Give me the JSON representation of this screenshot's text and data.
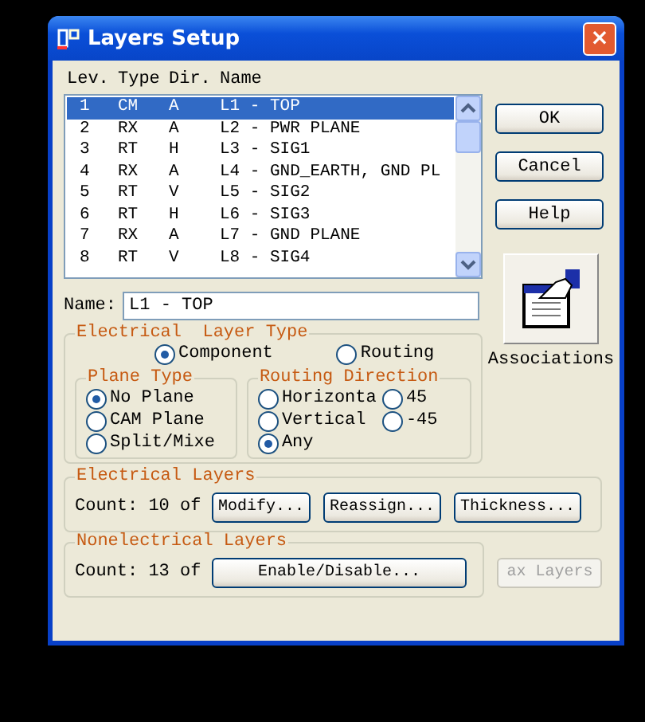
{
  "window": {
    "title": "Layers Setup",
    "close": "×"
  },
  "layer_list": {
    "columns": [
      "Lev.",
      "Type",
      "Dir.",
      "Name"
    ],
    "rows": [
      {
        "cells": [
          "1",
          "CM",
          "A",
          "L1 - TOP"
        ],
        "selected": true
      },
      {
        "cells": [
          "2",
          "RX",
          "A",
          "L2 - PWR PLANE"
        ],
        "selected": false
      },
      {
        "cells": [
          "3",
          "RT",
          "H",
          "L3 - SIG1"
        ],
        "selected": false
      },
      {
        "cells": [
          "4",
          "RX",
          "A",
          "L4 - GND_EARTH, GND PL"
        ],
        "selected": false
      },
      {
        "cells": [
          "5",
          "RT",
          "V",
          "L5 - SIG2"
        ],
        "selected": false
      },
      {
        "cells": [
          "6",
          "RT",
          "H",
          "L6 - SIG3"
        ],
        "selected": false
      },
      {
        "cells": [
          "7",
          "RX",
          "A",
          "L7 - GND PLANE"
        ],
        "selected": false
      },
      {
        "cells": [
          "8",
          "RT",
          "V",
          "L8 - SIG4"
        ],
        "selected": false
      }
    ]
  },
  "side_buttons": [
    {
      "label": "OK"
    },
    {
      "label": "Cancel"
    },
    {
      "label": "Help"
    }
  ],
  "associations": {
    "label": "Associations"
  },
  "name_field": {
    "label": "Name:",
    "value": "L1 - TOP"
  },
  "electrical_layer_type": {
    "title": "Electrical  Layer Type",
    "options": [
      {
        "label": "Component",
        "selected": true
      },
      {
        "label": "Routing",
        "selected": false
      }
    ],
    "plane_type": {
      "title": "Plane Type",
      "options": [
        {
          "label": "No Plane",
          "selected": true
        },
        {
          "label": "CAM Plane",
          "selected": false
        },
        {
          "label": "Split/Mixe",
          "selected": false
        }
      ]
    },
    "routing_direction": {
      "title": "Routing Direction",
      "options": [
        {
          "label": "Horizonta",
          "selected": false
        },
        {
          "label": "45",
          "selected": false
        },
        {
          "label": "Vertical",
          "selected": false
        },
        {
          "label": "-45",
          "selected": false
        },
        {
          "label": "Any",
          "selected": true
        }
      ]
    }
  },
  "electrical_layers": {
    "title": "Electrical Layers",
    "count": "Count: 10 of",
    "buttons": [
      {
        "label": "Modify..."
      },
      {
        "label": "Reassign..."
      },
      {
        "label": "Thickness..."
      }
    ]
  },
  "nonelectrical_layers": {
    "title": "Nonelectrical Layers",
    "count": "Count: 13 of",
    "buttons": [
      {
        "label": "Enable/Disable..."
      }
    ]
  },
  "max_layers_button": {
    "label": "ax Layers",
    "disabled": true
  }
}
